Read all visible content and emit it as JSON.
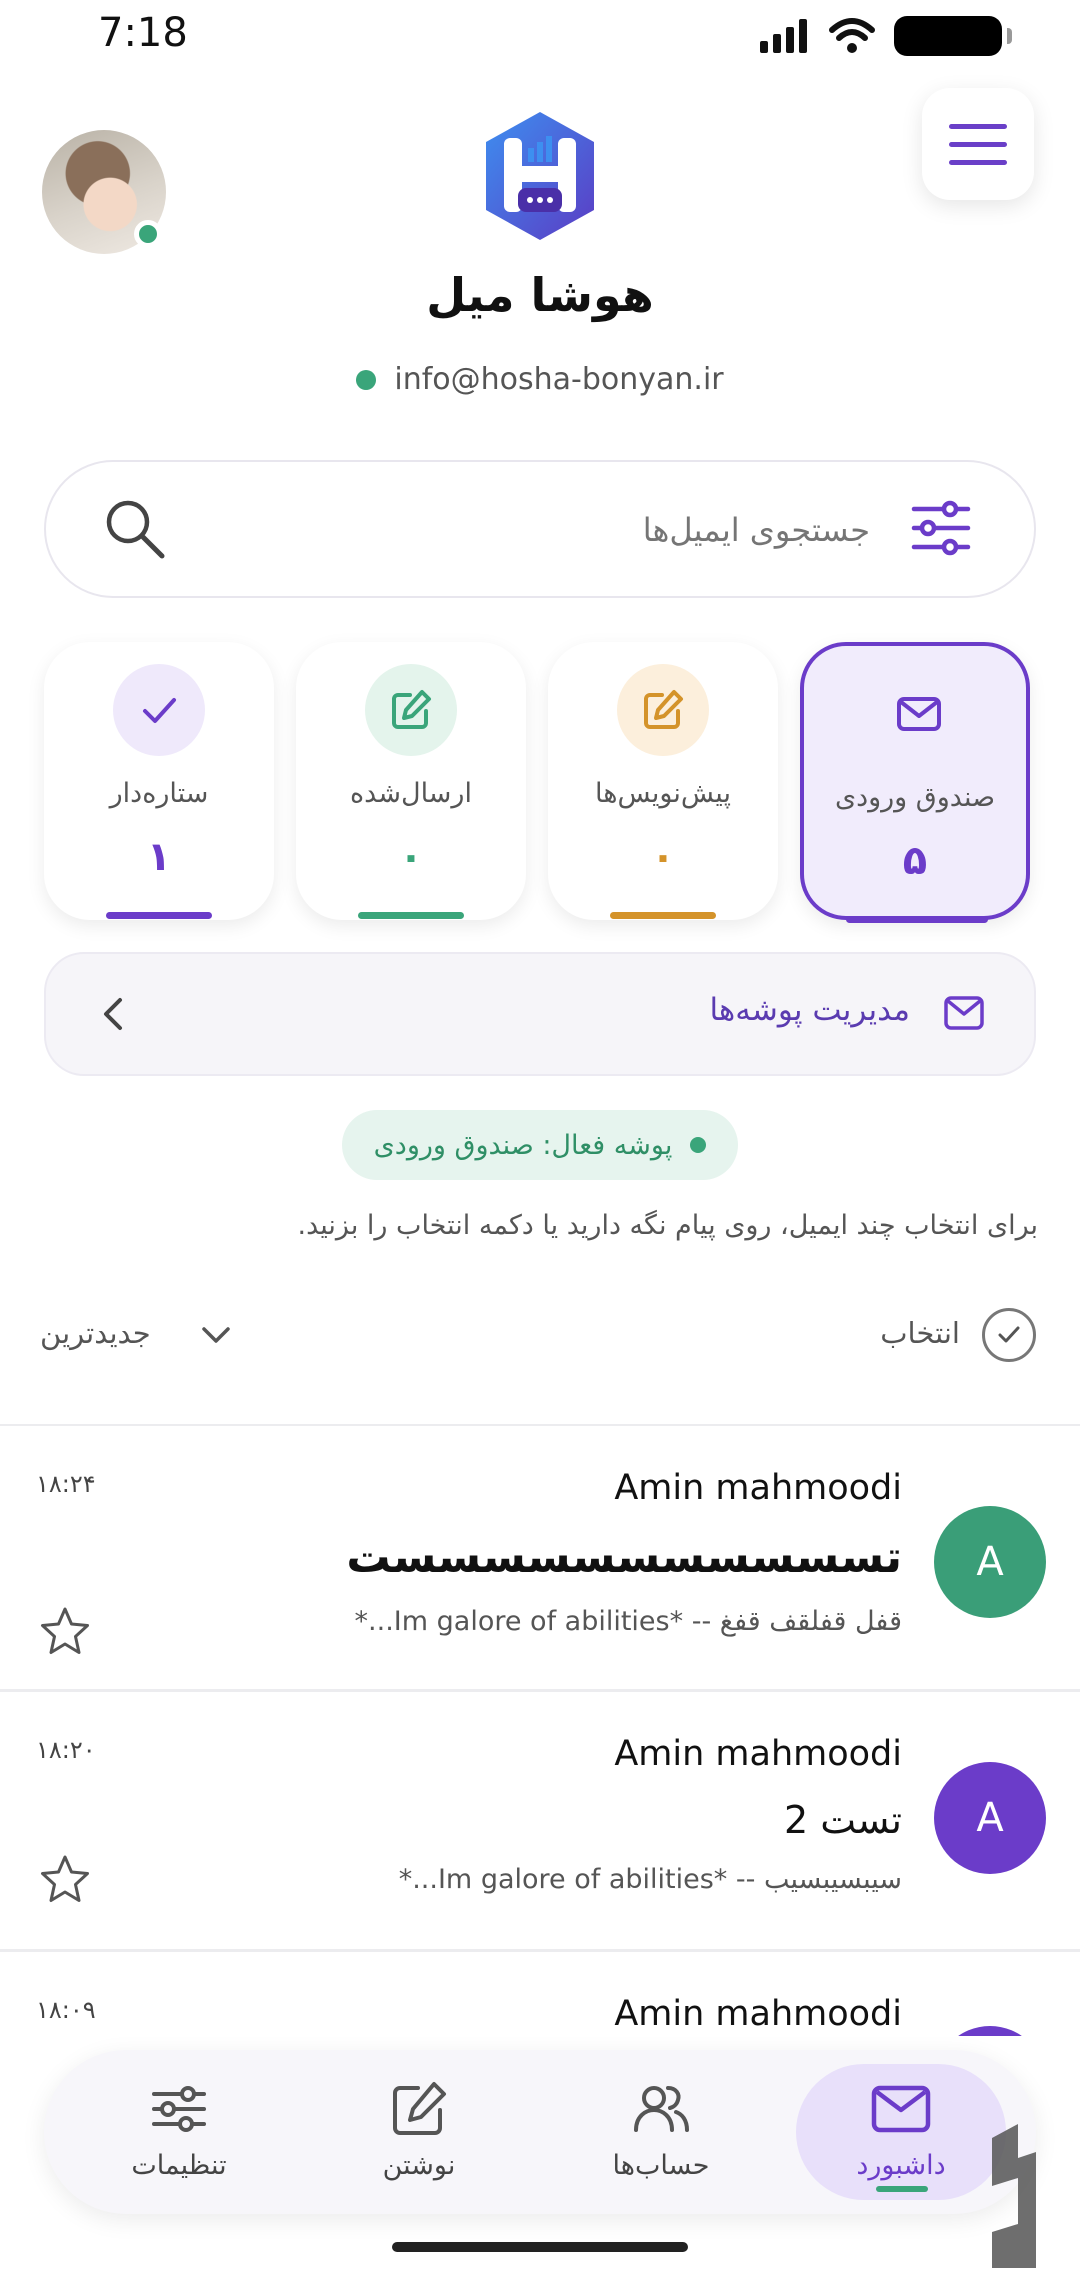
{
  "status_bar": {
    "time": "7:18"
  },
  "header": {
    "app_name": "هوشا میل",
    "account_email": "info@hosha-bonyan.ir",
    "online_color": "#3aa57a"
  },
  "search": {
    "placeholder": "جستجوی ایمیل‌ها"
  },
  "folders": [
    {
      "id": "inbox",
      "label": "صندوق ورودی",
      "count": "۵",
      "color": "#6b3cc9",
      "icon": "mail-icon",
      "active": true
    },
    {
      "id": "drafts",
      "label": "پیش‌نویس‌ها",
      "count": "۰",
      "color": "#d4932a",
      "icon": "edit-icon",
      "active": false
    },
    {
      "id": "sent",
      "label": "ارسال‌شده",
      "count": "۰",
      "color": "#3aa57a",
      "icon": "edit-icon",
      "active": false
    },
    {
      "id": "starred",
      "label": "ستاره‌دار",
      "count": "۱",
      "color": "#6b3cc9",
      "icon": "check-icon",
      "active": false
    }
  ],
  "manage_folders": {
    "label": "مدیریت پوشه‌ها"
  },
  "active_folder": {
    "label": "پوشه فعال: صندوق ورودی"
  },
  "hint": "برای انتخاب چند ایمیل، روی پیام نگه دارید یا دکمه انتخاب را بزنید.",
  "toolbar": {
    "select_label": "انتخاب",
    "sort_label": "جدیدترین"
  },
  "emails": [
    {
      "avatar_letter": "A",
      "avatar_color": "#3a9e78",
      "sender": "Amin mahmoodi",
      "subject": "تسسسسسسسسسسست",
      "preview": "قفل قفلقف قفغ -- *Im galore of abilities...*",
      "time": "۱۸:۲۴",
      "starred": false
    },
    {
      "avatar_letter": "A",
      "avatar_color": "#6b3cc9",
      "sender": "Amin mahmoodi",
      "subject": "تست 2",
      "preview": "سیبسیبسیب -- *Im galore of abilities...*",
      "time": "۱۸:۲۰",
      "starred": false
    },
    {
      "avatar_letter": "A",
      "avatar_color": "#6b3cc9",
      "sender": "Amin mahmoodi",
      "subject": "",
      "preview": "",
      "time": "۱۸:۰۹",
      "starred": false
    }
  ],
  "bottom_nav": [
    {
      "id": "dashboard",
      "label": "داشبورد",
      "icon": "mail-icon",
      "active": true
    },
    {
      "id": "accounts",
      "label": "حساب‌ها",
      "icon": "users-icon",
      "active": false
    },
    {
      "id": "compose",
      "label": "نوشتن",
      "icon": "edit-icon",
      "active": false
    },
    {
      "id": "settings",
      "label": "تنظیمات",
      "icon": "sliders-icon",
      "active": false
    }
  ]
}
